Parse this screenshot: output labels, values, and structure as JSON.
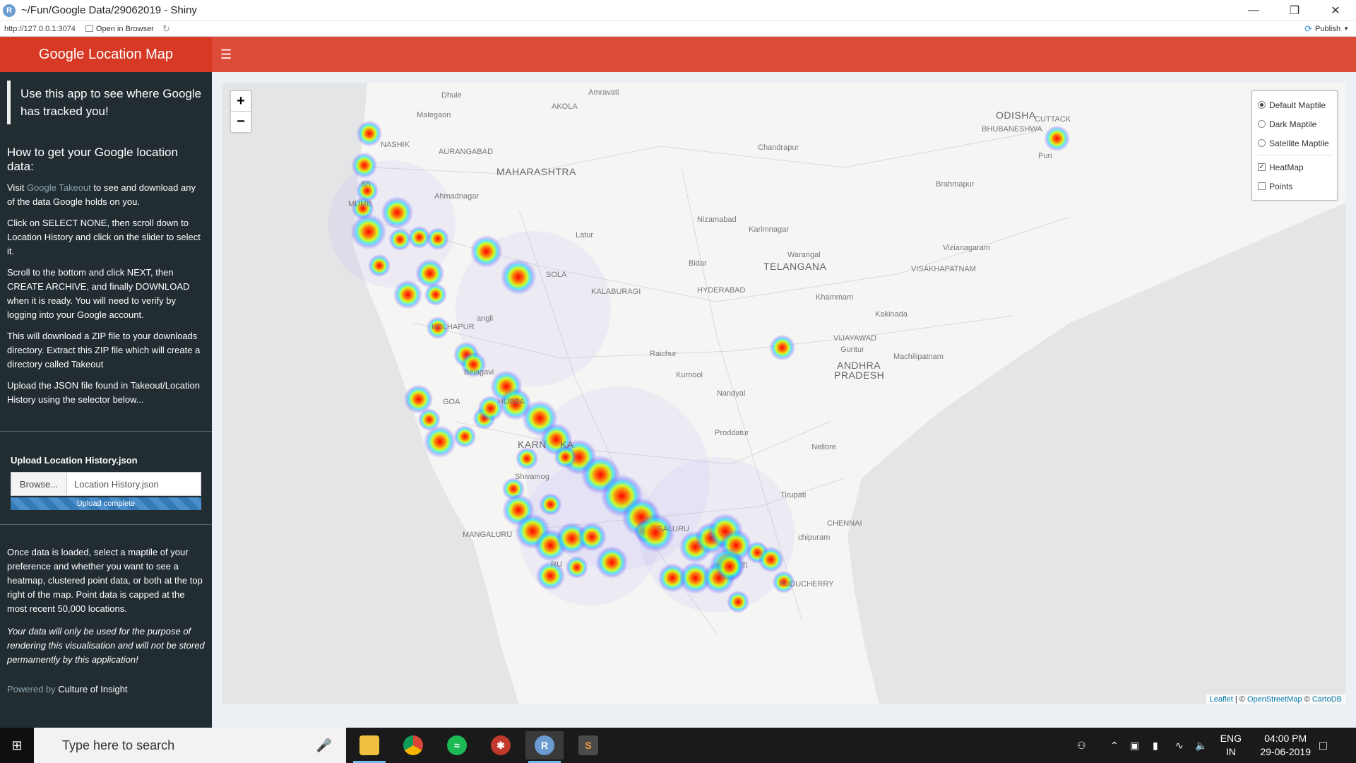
{
  "window": {
    "title": "~/Fun/Google Data/29062019 - Shiny",
    "app_icon_letter": "R"
  },
  "viewer_toolbar": {
    "url": "http://127.0.0.1:3074",
    "open_in_browser": "Open in Browser",
    "publish": "Publish"
  },
  "header": {
    "title": "Google Location Map",
    "menu_icon": "hamburger-icon"
  },
  "sidebar": {
    "intro": "Use this app to see where Google has tracked you!",
    "howto_title": "How to get your Google location data:",
    "visit_prefix": "Visit ",
    "visit_link": "Google Takeout",
    "visit_suffix": " to see and download any of the data Google holds on you.",
    "step1": "Click on SELECT NONE, then scroll down to Location History and click on the slider to select it.",
    "step2": "Scroll to the bottom and click NEXT, then CREATE ARCHIVE, and finally DOWNLOAD when it is ready. You will need to verify by logging into your Google account.",
    "step3": "This will download a ZIP file to your downloads directory. Extract this ZIP file which will create a directory called Takeout",
    "step4": "Upload the JSON file found in Takeout/Location History using the selector below...",
    "upload_label": "Upload Location History.json",
    "browse_button": "Browse...",
    "file_name": "Location History.json",
    "upload_status": "Upload complete",
    "once_loaded": "Once data is loaded, select a maptile of your preference and whether you want to see a heatmap, clustered point data, or both at the top right of the map. Point data is capped at the most recent 50,000 locations.",
    "privacy": "Your data will only be used for the purpose of rendering this visualisation and will not be stored permamently by this application!",
    "powered_prefix": "Powered by ",
    "powered_link": "Culture of Insight"
  },
  "map": {
    "zoom_in": "+",
    "zoom_out": "−",
    "layers": {
      "base": [
        {
          "label": "Default Maptile",
          "selected": true
        },
        {
          "label": "Dark Maptile",
          "selected": false
        },
        {
          "label": "Satellite Maptile",
          "selected": false
        }
      ],
      "overlays": [
        {
          "label": "HeatMap",
          "checked": true
        },
        {
          "label": "Points",
          "checked": false
        }
      ]
    },
    "attribution": {
      "leaflet": "Leaflet",
      "sep1": " | © ",
      "osm": "OpenStreetMap",
      "sep2": " © ",
      "carto": "CartoDB"
    },
    "places": {
      "dhule": "Dhule",
      "amravati": "Amravati",
      "akola": "AKOLA",
      "malegaon": "Malegaon",
      "nashik": "NASHIK",
      "aurangabad": "AURANGABAD",
      "maharashtra": "MAHARASHTRA",
      "ahmadnagar": "Ahmadnagar",
      "mumbai": "MUMB",
      "bhiwandi": "Bh",
      "chandrapur": "Chandrapur",
      "odisha": "ODISHA",
      "cuttack": "CUTTACK",
      "bhubaneswar": "BHUBANESHWA",
      "puri": "Puri",
      "brahmapur": "Brahmapur",
      "nizamabad": "Nizamabad",
      "karimnagar": "Karimnagar",
      "latur": "Latur",
      "warangal": "Warangal",
      "telangana": "TELANGANA",
      "bidar": "Bidar",
      "vizianagaram": "Vizianagaram",
      "visakhapatnam": "VISAKHAPATNAM",
      "solapur": "SOLA",
      "kalaburagi": "KALABURAGI",
      "hyderabad": "HYDERABAD",
      "khammam": "Khammam",
      "kakinada": "Kakinada",
      "kolhapur": "KOLHAPUR",
      "sangli": "angli",
      "vijayawada": "VIJAYAWAD",
      "guntur": "Guntur",
      "machilipatnam": "Machilipatnam",
      "raichur": "Raichur",
      "andhra": "ANDHRA",
      "pradesh": "PRADESH",
      "belagavi": "Belagavi",
      "kurnool": "Kurnool",
      "goa": "GOA",
      "hubballi": "HUBBA",
      "nandyal": "Nandyal",
      "proddatur": "Proddatur",
      "karnataka_a": "KARN",
      "karnataka_b": "KA",
      "nellore": "Nellore",
      "shivamogga": "Shivamog",
      "tirupati": "Tirupati",
      "chennai": "CHENNAI",
      "mangaluru": "MANGALURU",
      "bengaluru": "GALURU",
      "mysuru": "RU",
      "puducherry": "PUDUCHERRY",
      "kanchipuram": "chipuram",
      "tiruvannamalai": "Ti"
    }
  },
  "taskbar": {
    "search_placeholder": "Type here to search",
    "apps": [
      "file-explorer",
      "chrome",
      "spotify",
      "settings-web",
      "r-app",
      "sublime-app"
    ],
    "lang_top": "ENG",
    "lang_bottom": "IN",
    "time": "04:00 PM",
    "date": "29-06-2019"
  },
  "colors": {
    "header": "#dd4b39",
    "logo": "#d73925",
    "sidebar": "#222d32",
    "progress": "#337ab7"
  }
}
